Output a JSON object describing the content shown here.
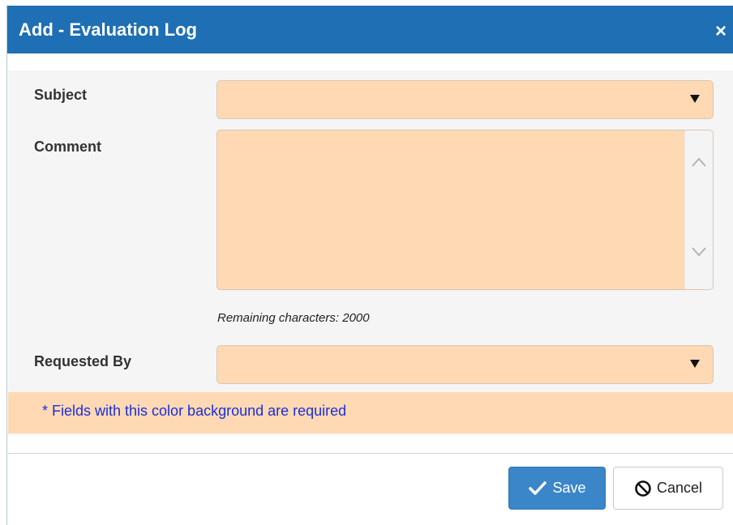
{
  "dialog": {
    "title": "Add - Evaluation Log",
    "close_glyph": "×"
  },
  "form": {
    "subject": {
      "label": "Subject",
      "value": ""
    },
    "comment": {
      "label": "Comment",
      "value": ""
    },
    "remaining": "Remaining characters: 2000",
    "requested_by": {
      "label": "Requested By",
      "value": ""
    },
    "required_note": "* Fields with this color background are required"
  },
  "actions": {
    "save_label": "Save",
    "cancel_label": "Cancel"
  },
  "colors": {
    "titlebar": "#1e6fb4",
    "required_field": "#ffd9b4",
    "note_text": "#1a2fd9",
    "save_button": "#3a86c9"
  },
  "icons": {
    "close": "close-icon",
    "dropdown": "chevron-down-icon",
    "scroll_up": "chevron-up-icon",
    "scroll_down": "chevron-down-icon",
    "save": "check-icon",
    "cancel": "ban-icon"
  }
}
